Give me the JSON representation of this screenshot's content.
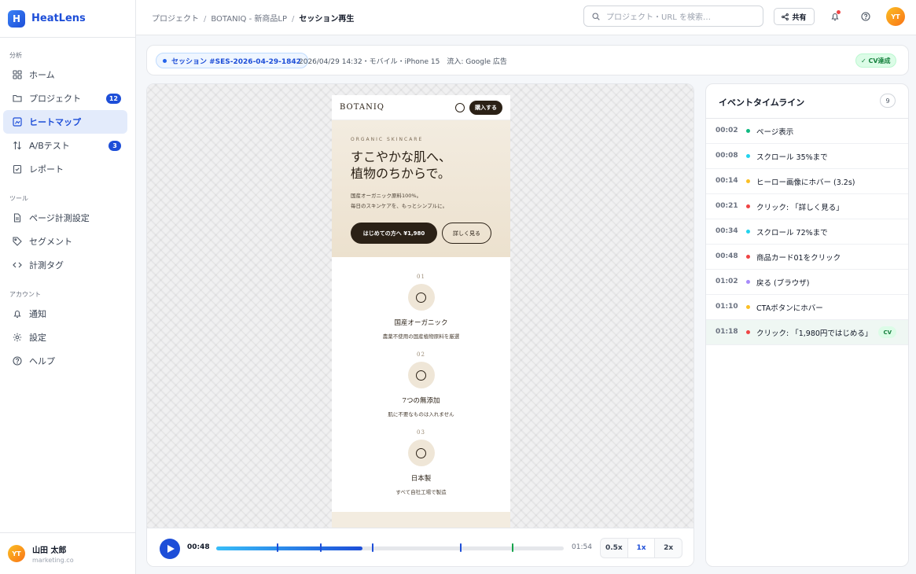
{
  "app": {
    "logo_letter": "H",
    "name": "HeatLens"
  },
  "sidebar": {
    "sections": [
      {
        "label": "分析",
        "items": [
          {
            "label": "ホーム",
            "icon": "grid-icon"
          },
          {
            "label": "プロジェクト",
            "icon": "folder-icon",
            "badge": "12"
          },
          {
            "label": "ヒートマップ",
            "icon": "heatmap-icon",
            "active": true
          },
          {
            "label": "A/Bテスト",
            "icon": "ab-test-icon",
            "badge": "3"
          },
          {
            "label": "レポート",
            "icon": "report-icon"
          }
        ]
      },
      {
        "label": "ツール",
        "items": [
          {
            "label": "ページ計測設定",
            "icon": "document-icon"
          },
          {
            "label": "セグメント",
            "icon": "tag-icon"
          },
          {
            "label": "計測タグ",
            "icon": "code-icon"
          }
        ]
      },
      {
        "label": "アカウント",
        "items": [
          {
            "label": "通知",
            "icon": "bell-icon"
          },
          {
            "label": "設定",
            "icon": "gear-icon"
          },
          {
            "label": "ヘルプ",
            "icon": "help-icon"
          }
        ]
      }
    ],
    "user": {
      "initials": "YT",
      "name": "山田 太郎",
      "org": "marketing.co"
    }
  },
  "topbar": {
    "breadcrumbs": [
      "プロジェクト",
      "BOTANIQ - 新商品LP",
      "セッション再生"
    ],
    "search_placeholder": "プロジェクト・URL を検索…",
    "share_label": "共有",
    "avatar_initials": "YT"
  },
  "session": {
    "id": "セッション #SES-2026-04-29-1842",
    "meta": "2026/04/29 14:32・モバイル・iPhone 15　流入: Google 広告",
    "status": "✓ CV達成"
  },
  "preview": {
    "brand": "BOTANIQ",
    "buy_label": "購入する",
    "eyebrow": "ORGANIC SKINCARE",
    "headline": "すこやかな肌へ、\n植物のちからで。",
    "lead": "国産オーガニック原料100%。\n毎日のスキンケアを、もっとシンプルに。",
    "cta_primary": "はじめての方へ ¥1,980",
    "cta_secondary": "詳しく見る",
    "features": [
      {
        "num": "01",
        "title": "国産オーガニック",
        "desc": "農薬不使用の国産植物原料を厳選"
      },
      {
        "num": "02",
        "title": "7つの無添加",
        "desc": "肌に不要なものは入れません"
      },
      {
        "num": "03",
        "title": "日本製",
        "desc": "すべて自社工場で製造"
      }
    ]
  },
  "player": {
    "current": "00:48",
    "total": "01:54",
    "progress": 0.42,
    "markers": [
      {
        "time": 0.175,
        "color": "#1d4ed8"
      },
      {
        "time": 0.298,
        "color": "#1d4ed8"
      },
      {
        "time": 0.447,
        "color": "#1d4ed8"
      },
      {
        "time": 0.702,
        "color": "#1d4ed8"
      },
      {
        "time": 0.851,
        "color": "#16a34a"
      }
    ],
    "speeds": [
      "0.5x",
      "1x",
      "2x"
    ],
    "active_speed": "1x"
  },
  "timeline": {
    "title": "イベントタイムライン",
    "count": "9",
    "events": [
      {
        "time": "00:02",
        "label": "ページ表示",
        "color": "#10b981"
      },
      {
        "time": "00:08",
        "label": "スクロール 35%まで",
        "color": "#22d3ee"
      },
      {
        "time": "00:14",
        "label": "ヒーロー画像にホバー (3.2s)",
        "color": "#fbbf24"
      },
      {
        "time": "00:21",
        "label": "クリック: 「詳しく見る」",
        "color": "#ef4444"
      },
      {
        "time": "00:34",
        "label": "スクロール 72%まで",
        "color": "#22d3ee"
      },
      {
        "time": "00:48",
        "label": "商品カード01をクリック",
        "color": "#ef4444"
      },
      {
        "time": "01:02",
        "label": "戻る (ブラウザ)",
        "color": "#a78bfa"
      },
      {
        "time": "01:10",
        "label": "CTAボタンにホバー",
        "color": "#fbbf24"
      },
      {
        "time": "01:18",
        "label": "クリック: 「1,980円ではじめる」",
        "color": "#ef4444",
        "tag": "CV",
        "active": true
      }
    ]
  },
  "colors": {
    "accent": "#1d4ed8",
    "success": "#15803d",
    "brand_dark": "#2b2116"
  }
}
